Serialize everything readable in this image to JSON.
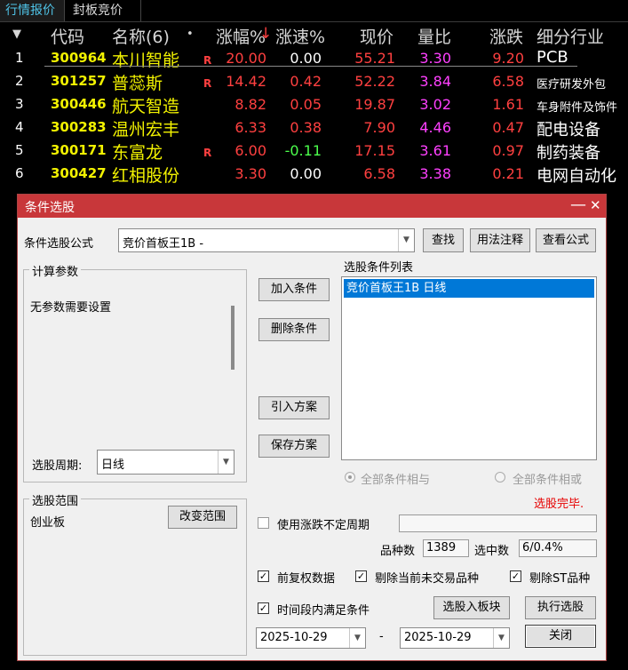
{
  "tabs": [
    {
      "label": "行情报价",
      "active": true
    },
    {
      "label": "封板竞价",
      "active": false
    }
  ],
  "grid": {
    "headers": {
      "arrow": "▼",
      "code": "代码",
      "name": "名称(6)",
      "dot": "•",
      "pct": "涨幅%",
      "sort": "↓",
      "speed": "涨速%",
      "price": "现价",
      "ratio": "量比",
      "change": "涨跌",
      "industry": "细分行业"
    },
    "rows": [
      {
        "idx": "1",
        "code": "300964",
        "name": "本川智能",
        "flag": "R",
        "pct": "20.00",
        "speed": "0.00",
        "price": "55.21",
        "ratio": "3.30",
        "change": "9.20",
        "industry": "PCB",
        "speed_color": "white"
      },
      {
        "idx": "2",
        "code": "301257",
        "name": "普蕊斯",
        "flag": "R",
        "pct": "14.42",
        "speed": "0.42",
        "price": "52.22",
        "ratio": "3.84",
        "change": "6.58",
        "industry": "医疗研发外包",
        "speed_color": "red"
      },
      {
        "idx": "3",
        "code": "300446",
        "name": "航天智造",
        "flag": "",
        "pct": "8.82",
        "speed": "0.05",
        "price": "19.87",
        "ratio": "3.02",
        "change": "1.61",
        "industry": "车身附件及饰件",
        "speed_color": "red"
      },
      {
        "idx": "4",
        "code": "300283",
        "name": "温州宏丰",
        "flag": "",
        "pct": "6.33",
        "speed": "0.38",
        "price": "7.90",
        "ratio": "4.46",
        "change": "0.47",
        "industry": "配电设备",
        "speed_color": "red"
      },
      {
        "idx": "5",
        "code": "300171",
        "name": "东富龙",
        "flag": "R",
        "pct": "6.00",
        "speed": "-0.11",
        "price": "17.15",
        "ratio": "3.61",
        "change": "0.97",
        "industry": "制药装备",
        "speed_color": "green"
      },
      {
        "idx": "6",
        "code": "300427",
        "name": "红相股份",
        "flag": "",
        "pct": "3.30",
        "speed": "0.00",
        "price": "6.58",
        "ratio": "3.38",
        "change": "0.21",
        "industry": "电网自动化",
        "speed_color": "white"
      }
    ]
  },
  "dialog": {
    "title": "条件选股",
    "minimize": "—",
    "close": "✕",
    "formula_label": "条件选股公式",
    "formula_value": "竞价首板王1B  -",
    "btn_find": "查找",
    "btn_usage": "用法注释",
    "btn_view": "查看公式",
    "params_group": "计算参数",
    "params_text": "无参数需要设置",
    "period_label": "选股周期:",
    "period_value": "日线",
    "btn_add": "加入条件",
    "btn_delete": "删除条件",
    "btn_import": "引入方案",
    "btn_save": "保存方案",
    "list_label": "选股条件列表",
    "list_items": [
      "竞价首板王1B  日线"
    ],
    "radio_and": "全部条件相与",
    "radio_or": "全部条件相或",
    "status": "选股完毕.",
    "range_group": "选股范围",
    "range_value": "创业板",
    "btn_change_range": "改变范围",
    "chk_uncertain": "使用涨跌不定周期",
    "count_label": "品种数",
    "count_value": "1389",
    "selected_label": "选中数",
    "selected_value": "6/0.4%",
    "chk_adjust": "前复权数据",
    "chk_exclude_untraded": "剔除当前未交易品种",
    "chk_exclude_st": "剔除ST品种",
    "chk_period_satisfy": "时间段内满足条件",
    "btn_to_block": "选股入板块",
    "btn_execute": "执行选股",
    "date_from": "2025-10-29",
    "date_sep": "-",
    "date_to": "2025-10-29",
    "btn_close": "关闭",
    "check_mark": "✓",
    "combo_arrow": "▼"
  },
  "colors": {
    "up": "#ff4040",
    "down": "#4cff4c",
    "ratio": "#ff40ff",
    "code": "#f2f200",
    "title_bar": "#c8373a",
    "status": "#e60000",
    "selection": "#0078d7"
  }
}
